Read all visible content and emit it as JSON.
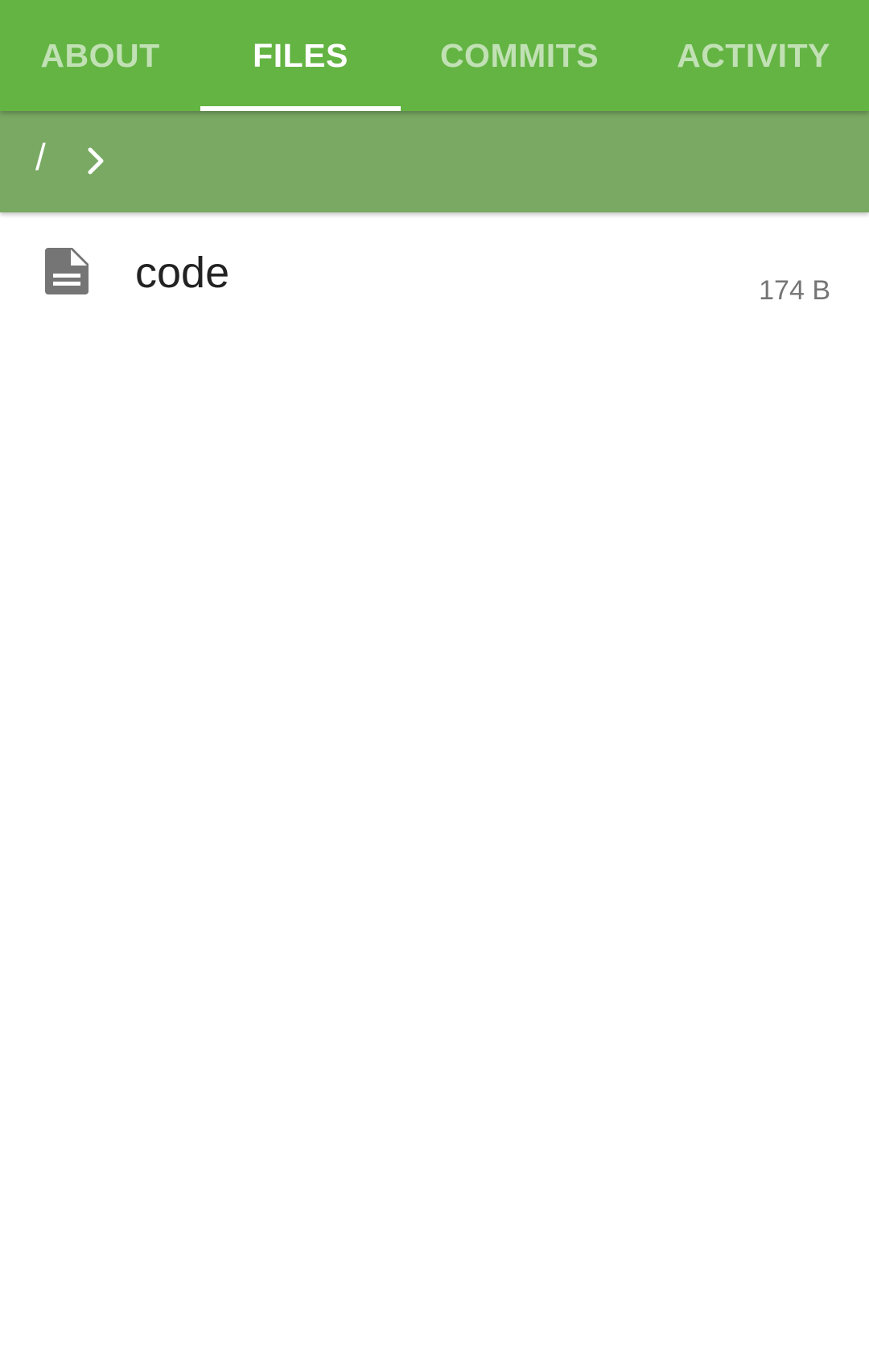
{
  "tabs": [
    {
      "label": "ABOUT",
      "active": false
    },
    {
      "label": "FILES",
      "active": true
    },
    {
      "label": "COMMITS",
      "active": false
    },
    {
      "label": "ACTIVITY",
      "active": false
    }
  ],
  "path": {
    "root": "/",
    "separator_icon": "chevron-right-icon"
  },
  "files": [
    {
      "name": "code",
      "size": "174 B",
      "icon": "file-document-icon"
    }
  ],
  "colors": {
    "primary": "#64b444",
    "path_bar": "#7aa963",
    "icon": "#757575"
  }
}
